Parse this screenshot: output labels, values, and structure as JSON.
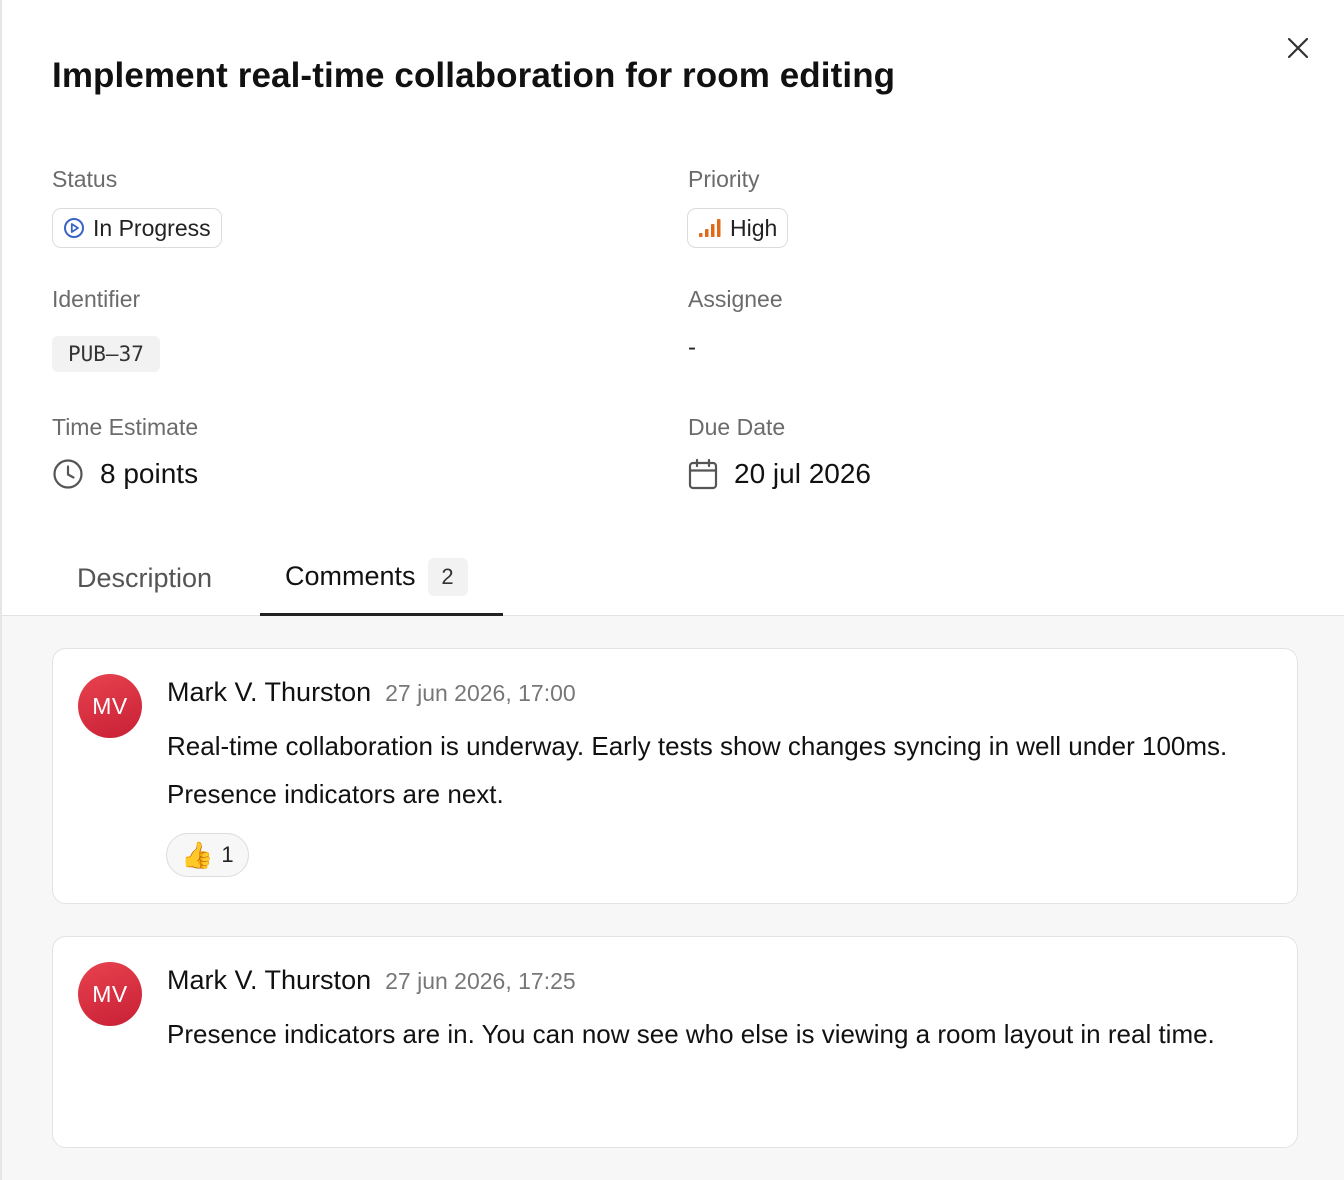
{
  "issue": {
    "title": "Implement real-time collaboration for room editing"
  },
  "fields": {
    "status": {
      "label": "Status",
      "value": "In Progress",
      "icon": "play-circle-icon",
      "color": "#3a63c8"
    },
    "priority": {
      "label": "Priority",
      "value": "High",
      "icon": "signal-bars-icon",
      "color": "#e06a1b"
    },
    "identifier": {
      "label": "Identifier",
      "value": "PUB–37"
    },
    "assignee": {
      "label": "Assignee",
      "value": "-"
    },
    "time_estimate": {
      "label": "Time Estimate",
      "value": "8 points",
      "icon": "clock-icon"
    },
    "due_date": {
      "label": "Due Date",
      "value": "20 jul 2026",
      "icon": "calendar-icon"
    }
  },
  "tabs": [
    {
      "label": "Description",
      "active": false
    },
    {
      "label": "Comments",
      "active": true,
      "count": "2"
    }
  ],
  "comments": [
    {
      "initials": "MV",
      "author": "Mark V. Thurston",
      "timestamp": "27 jun 2026, 17:00",
      "text": "Real-time collaboration is underway. Early tests show changes syncing in well under 100ms. Presence indicators are next.",
      "reaction": {
        "emoji": "👍",
        "count": "1"
      }
    },
    {
      "initials": "MV",
      "author": "Mark V. Thurston",
      "timestamp": "27 jun 2026, 17:25",
      "text": "Presence indicators are in. You can now see who else is viewing a room layout in real time."
    }
  ],
  "colors": {
    "avatar": "#d92b3f",
    "active_tab_underline": "#222222"
  }
}
